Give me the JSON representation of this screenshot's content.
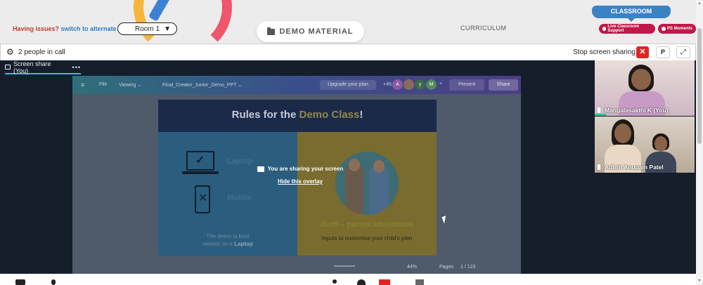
{
  "header": {
    "issues_text": "Having issues?",
    "alt_room_link": "switch to alternate room",
    "room_value": "Room 1",
    "demo_material": "DEMO MATERIAL",
    "curriculum": "CURRICULUM",
    "classroom_tab": "CLASSROOM",
    "live_support": "Live Classroom Support",
    "ps_moments": "PS Moments"
  },
  "call": {
    "people_count": "2 people in call",
    "stop_sharing": "Stop screen sharing",
    "close_symbol": "✕",
    "p_button": "P",
    "expand_symbol": "⤢",
    "share_tab": "Screen share (You)",
    "tab_dots": "•••"
  },
  "canva": {
    "menu": "≡",
    "file": "File",
    "viewing": "Viewing ⌄",
    "doc_title": "Final_Creator_Junior_Demo_PPT ⌄",
    "upgrade": "Upgrade your plan",
    "collab_count": "+45",
    "avatars": [
      "A",
      "",
      "y",
      "M"
    ],
    "plus": "+",
    "present": "Present",
    "share": "Share",
    "zoom": "44%",
    "pages_label": "Pages",
    "page_count": "1 / 123"
  },
  "slide": {
    "title_prefix": "Rules for the ",
    "title_highlight": "Demo Class",
    "title_suffix": "!",
    "laptop_label": "Laptop",
    "mobile_label": "Mobile",
    "demo_note_line1": "The demo is best",
    "demo_note_line2": "viewed on a ",
    "demo_note_bold": "Laptop",
    "both_title": "Both – parent attendance",
    "both_sub": "Inputs to customise your child's plan"
  },
  "overlay": {
    "sharing_text": "You are sharing your screen",
    "hide_link": "Hide this overlay"
  },
  "participants": [
    {
      "name": "Mangalasakthi K (You)"
    },
    {
      "name": "Adhrit Anupam Patel"
    }
  ],
  "colors": {
    "accent_red": "#e02424",
    "brand_blue": "#3b82c4",
    "pill_crimson": "#c0184a",
    "stage_bg": "#151e2b",
    "tab_underline": "#3fb9d6"
  }
}
